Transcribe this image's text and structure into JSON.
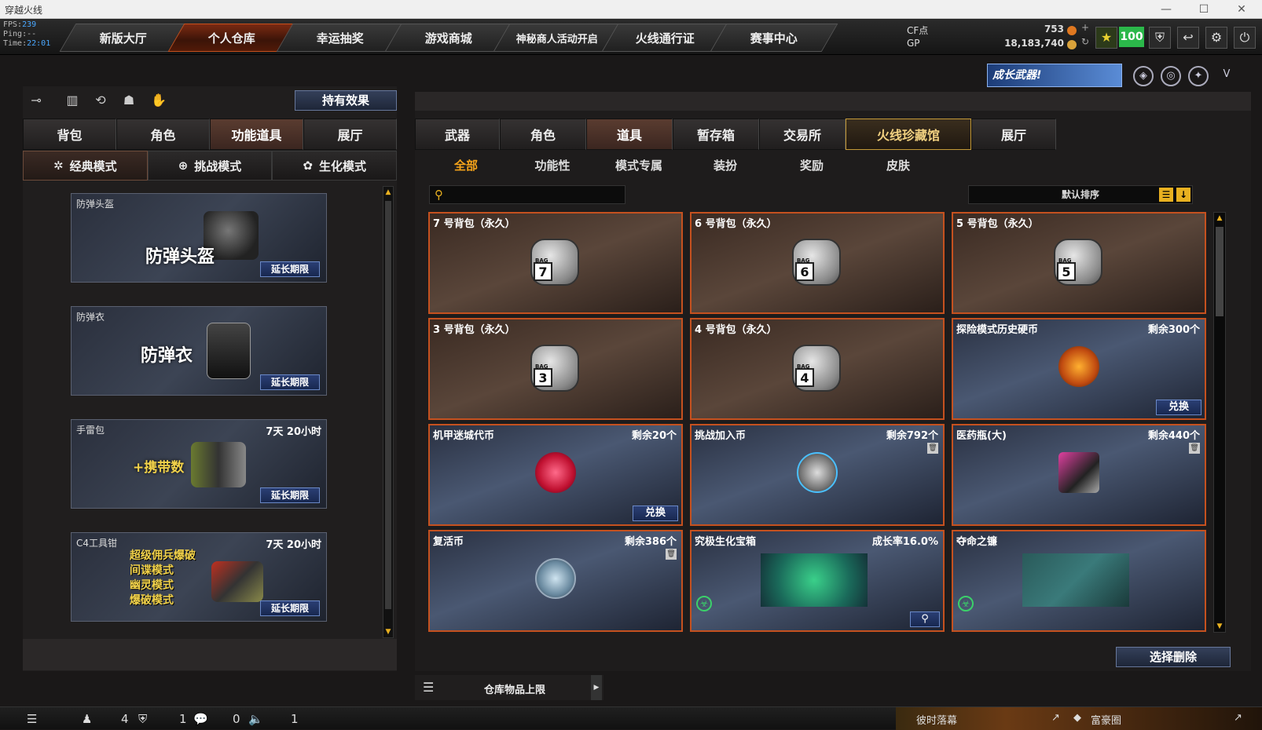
{
  "window": {
    "title": "穿越火线",
    "minimize": "—",
    "maximize": "☐",
    "close": "✕"
  },
  "perf": {
    "fps_label": "FPS:",
    "fps": "239",
    "ping_label": "Ping:",
    "ping": "--",
    "time_label": "Time:",
    "time": "22:01"
  },
  "nav": [
    {
      "label": "新版大厅"
    },
    {
      "label": "个人仓库"
    },
    {
      "label": "幸运抽奖"
    },
    {
      "label": "游戏商城"
    },
    {
      "label": "神秘商人活动开启"
    },
    {
      "label": "火线通行证"
    },
    {
      "label": "赛事中心"
    }
  ],
  "currency": {
    "cf_label": "CF点",
    "cf_value": "753",
    "gp_label": "GP",
    "gp_value": "18,183,740"
  },
  "level": "100",
  "growth_banner": "成长武器!",
  "left": {
    "effect_button": "持有效果",
    "tabs": [
      {
        "label": "背包"
      },
      {
        "label": "角色"
      },
      {
        "label": "功能道具"
      },
      {
        "label": "展厅"
      }
    ],
    "modes": [
      {
        "label": "经典模式",
        "icon": "✲"
      },
      {
        "label": "挑战模式",
        "icon": "⊕"
      },
      {
        "label": "生化模式",
        "icon": "✿"
      }
    ],
    "cards": [
      {
        "name": "防弹头盔",
        "big": "防弹头盔",
        "time": "",
        "extend": "延长期限"
      },
      {
        "name": "防弹衣",
        "big": "防弹衣",
        "time": "",
        "extend": "延长期限"
      },
      {
        "name": "手雷包",
        "big": "+携带数",
        "time": "7天 20小时",
        "extend": "延长期限"
      },
      {
        "name": "C4工具钳",
        "lines": [
          "超级佣兵爆破",
          "间谍模式",
          "幽灵模式",
          "爆破模式"
        ],
        "time": "7天 20小时",
        "extend": "延长期限"
      }
    ]
  },
  "right": {
    "tabs": [
      {
        "label": "武器"
      },
      {
        "label": "角色"
      },
      {
        "label": "道具"
      },
      {
        "label": "暂存箱"
      },
      {
        "label": "交易所"
      },
      {
        "label": "火线珍藏馆"
      },
      {
        "label": "展厅"
      }
    ],
    "subtabs": [
      {
        "label": "全部"
      },
      {
        "label": "功能性"
      },
      {
        "label": "模式专属"
      },
      {
        "label": "装扮"
      },
      {
        "label": "奖励"
      },
      {
        "label": "皮肤"
      }
    ],
    "search_placeholder": "",
    "sort_label": "默认排序",
    "items": [
      {
        "name": "7 号背包（永久）",
        "right": "",
        "bag": "7"
      },
      {
        "name": "6 号背包（永久）",
        "right": "",
        "bag": "6"
      },
      {
        "name": "5 号背包（永久）",
        "right": "",
        "bag": "5"
      },
      {
        "name": "3 号背包（永久）",
        "right": "",
        "bag": "3"
      },
      {
        "name": "4 号背包（永久）",
        "right": "",
        "bag": "4"
      },
      {
        "name": "探险模式历史硬币",
        "right": "剩余300个",
        "button": "兑换"
      },
      {
        "name": "机甲迷城代币",
        "right": "剩余20个",
        "button": "兑换"
      },
      {
        "name": "挑战加入币",
        "right": "剩余792个"
      },
      {
        "name": "医药瓶(大)",
        "right": "剩余440个"
      },
      {
        "name": "复活币",
        "right": "剩余386个"
      },
      {
        "name": "究极生化宝箱",
        "right": "成长率16.0%"
      },
      {
        "name": "夺命之镰",
        "right": ""
      }
    ],
    "bag_tag": "BAG",
    "delete_button": "选择删除",
    "limit_label": "仓库物品上限"
  },
  "status": {
    "a": "4",
    "b": "1",
    "c": "0",
    "d": "1",
    "left_text": "彼时落幕",
    "right_text": "富豪圈"
  },
  "colors": {
    "accent": "#c5511f",
    "gold": "#e8b020",
    "active_text": "#f5a31a"
  }
}
